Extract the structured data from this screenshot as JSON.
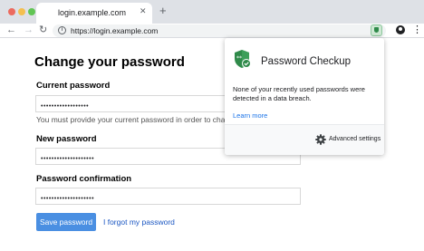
{
  "browser": {
    "tab_title": "login.example.com",
    "tab_close": "✕",
    "new_tab": "+",
    "url": "https://login.example.com",
    "back": "←",
    "forward": "→",
    "reload": "↻",
    "info": "i",
    "menu": "⋮"
  },
  "page": {
    "title": "Change your password",
    "current_label": "Current password",
    "current_value": "••••••••••••••••••",
    "hint": "You must provide your current password in order to change it.",
    "new_label": "New password",
    "new_value": "••••••••••••••••••••",
    "confirm_label": "Password confirmation",
    "confirm_value": "••••••••••••••••••••",
    "save_label": "Save password",
    "forgot_label": "I forgot my password"
  },
  "popup": {
    "title": "Password Checkup",
    "message": "None of your recently used passwords were detected in a data breach.",
    "learn_more": "Learn more",
    "advanced": "Advanced settings"
  },
  "colors": {
    "accent_button": "#4a8fe2",
    "link": "#1a56c2",
    "shield_green": "#2f8a4a"
  }
}
